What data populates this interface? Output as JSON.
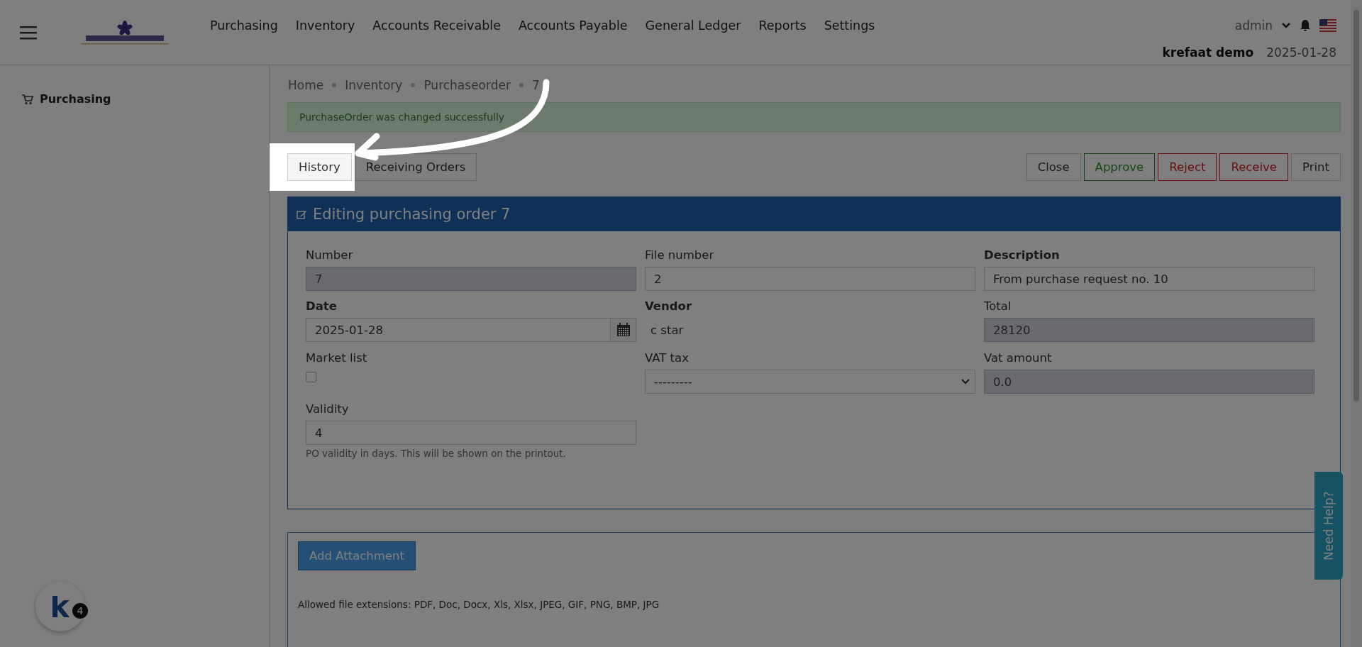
{
  "header": {
    "menu": [
      "Purchasing",
      "Inventory",
      "Accounts Receivable",
      "Accounts Payable",
      "General Ledger",
      "Reports",
      "Settings"
    ],
    "user": "admin",
    "company": "krefaat demo",
    "date": "2025-01-28"
  },
  "sidebar": {
    "items": [
      {
        "label": "Purchasing",
        "selected": false
      }
    ]
  },
  "breadcrumb": [
    "Home",
    "Inventory",
    "Purchaseorder",
    "7"
  ],
  "alert": "PurchaseOrder was changed successfully",
  "left_buttons": [
    {
      "label": "History",
      "highlighted": true
    },
    {
      "label": "Receiving Orders",
      "highlighted": false
    }
  ],
  "right_buttons": [
    {
      "label": "Close",
      "kind": "default"
    },
    {
      "label": "Approve",
      "kind": "success"
    },
    {
      "label": "Reject",
      "kind": "danger"
    },
    {
      "label": "Receive",
      "kind": "danger"
    },
    {
      "label": "Print",
      "kind": "default"
    }
  ],
  "panel": {
    "title": "Editing purchasing order 7",
    "fields": [
      {
        "label": "Number",
        "required": false,
        "kind": "input",
        "value": "7",
        "readonly": true
      },
      {
        "label": "File number",
        "required": false,
        "kind": "input",
        "value": "2",
        "readonly": false
      },
      {
        "label": "Description",
        "required": true,
        "kind": "input",
        "value": "From purchase request no. 10",
        "readonly": false
      },
      {
        "label": "Date",
        "required": true,
        "kind": "date",
        "value": "2025-01-28"
      },
      {
        "label": "Vendor",
        "required": true,
        "kind": "text",
        "value": "c star"
      },
      {
        "label": "Total",
        "required": false,
        "kind": "input",
        "value": "28120",
        "readonly": true
      },
      {
        "label": "Market list",
        "required": false,
        "kind": "checkbox",
        "checked": false
      },
      {
        "label": "VAT tax",
        "required": false,
        "kind": "select",
        "value": "---------"
      },
      {
        "label": "Vat amount",
        "required": false,
        "kind": "input",
        "value": "0.0",
        "readonly": true
      },
      {
        "label": "Validity",
        "required": false,
        "kind": "input",
        "value": "4",
        "readonly": false,
        "help": "PO validity in days. This will be shown on the printout."
      }
    ]
  },
  "attachments": {
    "button": "Add Attachment",
    "allowed": "Allowed file extensions: PDF, Doc, Docx, Xls, Xlsx, JPEG, GIF, PNG, BMP, JPG"
  },
  "help_tab": "Need Help?",
  "chat_badge": {
    "count": "4"
  }
}
